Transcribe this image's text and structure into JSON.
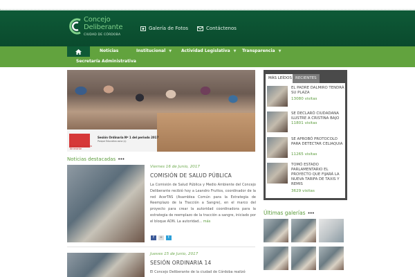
{
  "header": {
    "logo_line1": "Concejo",
    "logo_line2": "Deliberante",
    "logo_line3": "CIUDAD DE CÓRDOBA",
    "link_gallery": "Galería de Fotos",
    "link_contact": "Contáctenos"
  },
  "nav": {
    "items": [
      {
        "label": "Noticias",
        "has_dropdown": false
      },
      {
        "label": "Institucional",
        "has_dropdown": true
      },
      {
        "label": "Actividad Legislativa",
        "has_dropdown": true
      },
      {
        "label": "Transparencia",
        "has_dropdown": true
      },
      {
        "label": "Secretaría Administrativa",
        "has_dropdown": false
      }
    ]
  },
  "hero": {
    "caption_title": "Sesión Ordinaria Nº 1 del periodo 2017",
    "caption_sub": "Parque Educativo zona (s)",
    "caption_logo": "Programa Concejo Itinerante"
  },
  "news": {
    "section_title": "Noticias destacadas",
    "articles": [
      {
        "date": "Viernes 16 de Junio, 2017",
        "title": "COMISIÓN DE SALUD PÚBLICA",
        "text": "La Comisión de Salud Pública y Medio Ambiente del Concejo Deliberante recibió hoy a Leandro Fruttos, coordinador de la red AcerTAS (Asamblea Común para la Estrategia de Reemplazo de la Tracción a Sangre), en el marco del proyecto para crear la autoridad coordinadora para la estrategia de reemplazo de la tracción a sangre, iniciado por el bloque ADN. La autoridad...",
        "more": "más"
      },
      {
        "date": "Jueves 15 de Junio, 2017",
        "title": "SESIÓN ORDINARIA 14",
        "text": "El Concejo Deliberante de la ciudad de Córdoba realizó"
      }
    ],
    "share": [
      "f",
      "+",
      "t"
    ]
  },
  "sidebar": {
    "tab_active": "MÁS LEÍDOS",
    "tab_inactive": "RECIENTES",
    "items": [
      {
        "title": "EL PADRE DALMIRO TENDRÁ SU PLAZA",
        "views": "13080 visitas"
      },
      {
        "title": "SE DECLARÓ CIUDADANA ILUSTRE A CRISTINA BAJO",
        "views": "11801 visitas"
      },
      {
        "title": "SE APROBÓ PROTOCOLO PARA DETECTAR CELIAQUIA",
        "views": "11265 visitas"
      },
      {
        "title": "TOMÓ ESTADO PARLAMENTARIO EL PROYECTO QUE FIJARÁ LA NUEVA TARIFA DE TAXIS Y REMIS",
        "views": "3629 visitas"
      }
    ]
  },
  "galleries": {
    "title": "Últimas galerías"
  },
  "colors": {
    "header_green": "#0e5a37",
    "nav_green": "#62a33e",
    "accent_green": "#5a9b3a"
  }
}
